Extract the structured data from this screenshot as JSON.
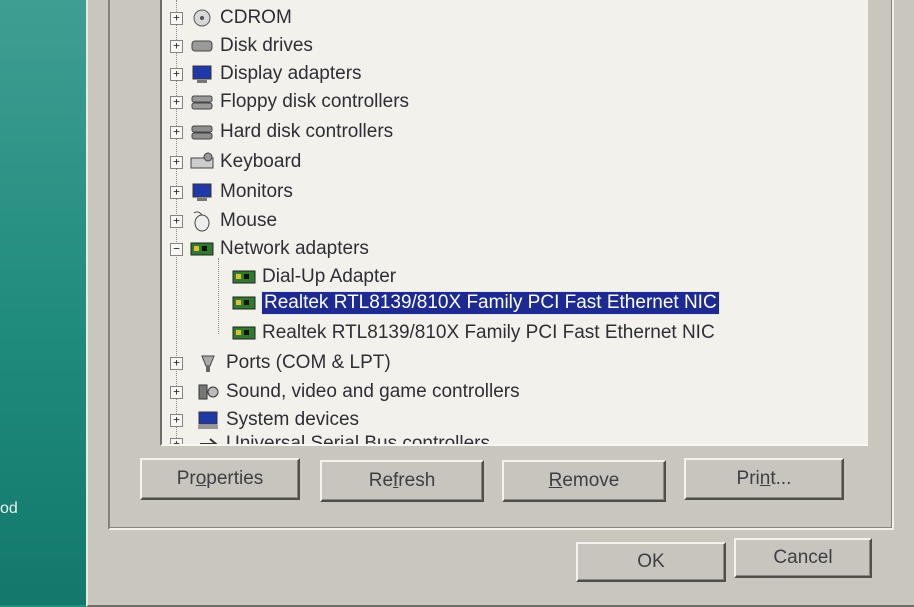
{
  "desktop": {
    "label": "od"
  },
  "tree": {
    "items": [
      {
        "label": "CDROM",
        "icon": "cdrom-icon",
        "expander": "+"
      },
      {
        "label": "Disk drives",
        "icon": "disk-drive-icon",
        "expander": "+"
      },
      {
        "label": "Display adapters",
        "icon": "display-adapter-icon",
        "expander": "+"
      },
      {
        "label": "Floppy disk controllers",
        "icon": "floppy-controller-icon",
        "expander": "+"
      },
      {
        "label": "Hard disk controllers",
        "icon": "hard-disk-controller-icon",
        "expander": "+"
      },
      {
        "label": "Keyboard",
        "icon": "keyboard-icon",
        "expander": "+"
      },
      {
        "label": "Monitors",
        "icon": "monitor-icon",
        "expander": "+"
      },
      {
        "label": "Mouse",
        "icon": "mouse-icon",
        "expander": "+"
      },
      {
        "label": "Network adapters",
        "icon": "network-adapter-icon",
        "expander": "−"
      },
      {
        "label": "Dial-Up Adapter",
        "icon": "network-card-icon"
      },
      {
        "label": "Realtek RTL8139/810X Family PCI Fast Ethernet NIC",
        "icon": "network-card-icon",
        "selected": true
      },
      {
        "label": "Realtek RTL8139/810X Family PCI Fast Ethernet NIC",
        "icon": "network-card-icon"
      },
      {
        "label": "Ports (COM & LPT)",
        "icon": "port-icon",
        "expander": "+"
      },
      {
        "label": "Sound, video and game controllers",
        "icon": "sound-icon",
        "expander": "+"
      },
      {
        "label": "System devices",
        "icon": "system-device-icon",
        "expander": "+"
      },
      {
        "label": "Universal Serial Bus controllers",
        "icon": "usb-icon",
        "expander": "+"
      }
    ]
  },
  "buttons": {
    "properties": {
      "pre": "Pr",
      "u": "o",
      "post": "perties"
    },
    "refresh": {
      "pre": "Re",
      "u": "f",
      "post": "resh"
    },
    "remove": {
      "pre": "",
      "u": "R",
      "post": "emove"
    },
    "print": {
      "pre": "Pri",
      "u": "n",
      "post": "t..."
    },
    "ok": "OK",
    "cancel": "Cancel"
  },
  "colors": {
    "selection": "#1d2a92",
    "desktop": "#1f8f82",
    "window": "#c9c6bd"
  }
}
